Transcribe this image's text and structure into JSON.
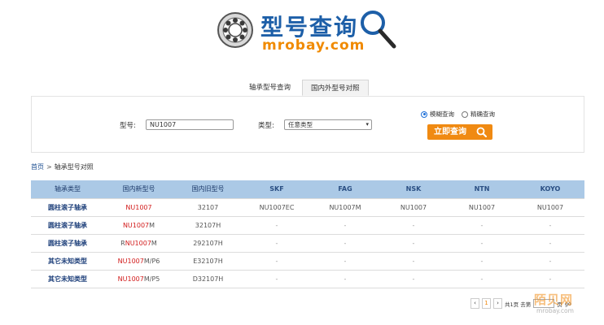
{
  "logo": {
    "title": "型号查询",
    "domain": "mrobay.com"
  },
  "tabs": [
    {
      "label": "轴承型号查询",
      "active": false
    },
    {
      "label": "国内外型号对照",
      "active": true
    }
  ],
  "search": {
    "model_label": "型号:",
    "model_value": "NU1007",
    "type_label": "类型:",
    "type_value": "任意类型",
    "radio_fuzzy": "模糊查询",
    "radio_exact": "精确查询",
    "search_button": "立即查询"
  },
  "breadcrumb": {
    "home": "首页",
    "separator": ">",
    "current": "轴承型号对照"
  },
  "table": {
    "headers": [
      "轴承类型",
      "国内新型号",
      "国内旧型号",
      "SKF",
      "FAG",
      "NSK",
      "NTN",
      "KOYO"
    ],
    "rows": [
      {
        "category": "圆柱滚子轴承",
        "new_prefix": "",
        "new_red": "NU1007",
        "new_suffix": "",
        "old": "32107",
        "skf": "NU1007EC",
        "fag": "NU1007M",
        "nsk": "NU1007",
        "ntn": "NU1007",
        "koyo": "NU1007"
      },
      {
        "category": "圆柱滚子轴承",
        "new_prefix": "",
        "new_red": "NU1007",
        "new_suffix": "M",
        "old": "32107H",
        "skf": "-",
        "fag": "-",
        "nsk": "-",
        "ntn": "-",
        "koyo": "-"
      },
      {
        "category": "圆柱滚子轴承",
        "new_prefix": "R",
        "new_red": "NU1007",
        "new_suffix": "M",
        "old": "292107H",
        "skf": "-",
        "fag": "-",
        "nsk": "-",
        "ntn": "-",
        "koyo": "-"
      },
      {
        "category": "其它未知类型",
        "new_prefix": "",
        "new_red": "NU1007",
        "new_suffix": "M/P6",
        "old": "E32107H",
        "skf": "-",
        "fag": "-",
        "nsk": "-",
        "ntn": "-",
        "koyo": "-"
      },
      {
        "category": "其它未知类型",
        "new_prefix": "",
        "new_red": "NU1007",
        "new_suffix": "M/P5",
        "old": "D32107H",
        "skf": "-",
        "fag": "-",
        "nsk": "-",
        "ntn": "-",
        "koyo": "-"
      }
    ]
  },
  "pager": {
    "prev": "‹",
    "current": "1",
    "next": "›",
    "total": "共1页 去第",
    "page_unit": "页",
    "go": "go"
  },
  "watermark": {
    "main": "陌贝网",
    "sub": "mrobay.com"
  },
  "colors": {
    "brand_blue": "#1d5fa8",
    "brand_orange": "#f08a12",
    "header_bg": "#abc9e6",
    "highlight_red": "#d21c1c"
  }
}
